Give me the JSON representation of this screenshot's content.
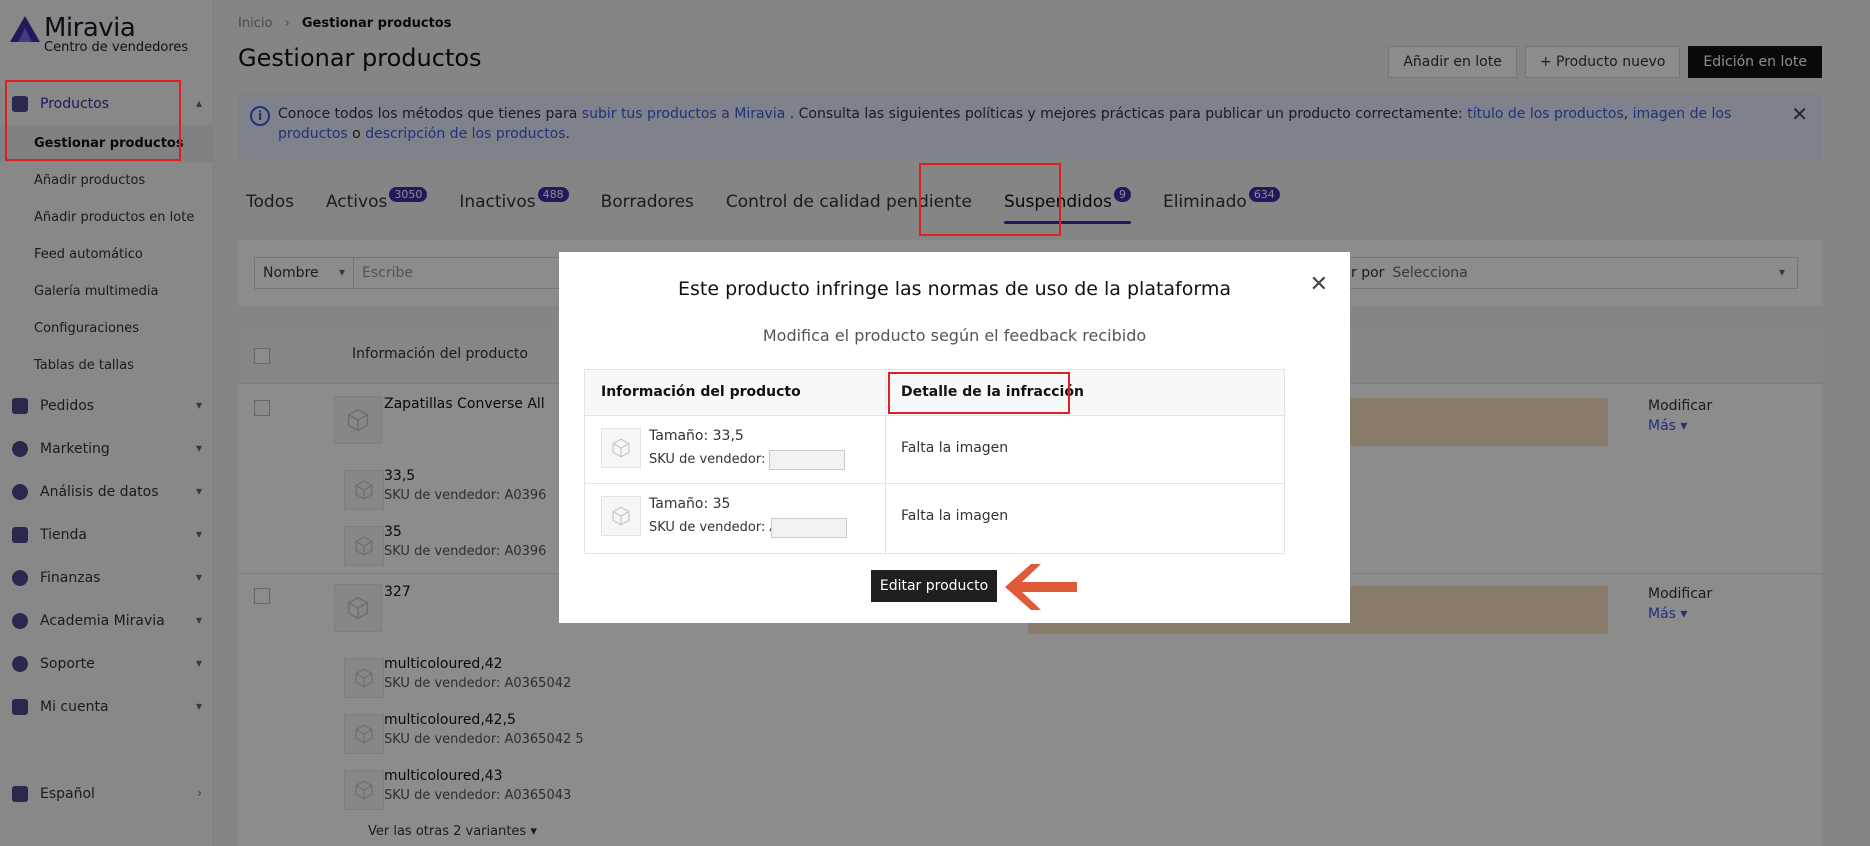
{
  "brand": {
    "name": "Miravia",
    "subtitle": "Centro de vendedores"
  },
  "sidebar": {
    "products_label": "Productos",
    "products_sub": [
      {
        "label": "Gestionar productos"
      },
      {
        "label": "Añadir productos"
      },
      {
        "label": "Añadir productos en lote"
      },
      {
        "label": "Feed automático"
      },
      {
        "label": "Galería multimedia"
      },
      {
        "label": "Configuraciones"
      },
      {
        "label": "Tablas de tallas"
      }
    ],
    "groups": [
      {
        "label": "Pedidos"
      },
      {
        "label": "Marketing"
      },
      {
        "label": "Análisis de datos"
      },
      {
        "label": "Tienda"
      },
      {
        "label": "Finanzas"
      },
      {
        "label": "Academia Miravia"
      },
      {
        "label": "Soporte"
      },
      {
        "label": "Mi cuenta"
      }
    ],
    "language": "Español"
  },
  "breadcrumb": {
    "home": "Inicio",
    "current": "Gestionar productos"
  },
  "page_title": "Gestionar productos",
  "actions": {
    "batch_add": "Añadir en lote",
    "new_product": "+ Producto nuevo",
    "batch_edit": "Edición en lote"
  },
  "banner": {
    "t1": "Conoce todos los métodos que tienes para ",
    "l1": "subir tus productos a Miravia",
    "t2": " . Consulta las siguientes políticas y mejores prácticas para publicar un producto correctamente: ",
    "l2": "título de los productos",
    "t3": ", ",
    "l3": "imagen de los productos",
    "t4": " o ",
    "l4": "descripción de los productos",
    "t5": "."
  },
  "tabs": [
    {
      "label": "Todos",
      "badge": ""
    },
    {
      "label": "Activos",
      "badge": "3050"
    },
    {
      "label": "Inactivos",
      "badge": "488"
    },
    {
      "label": "Borradores",
      "badge": ""
    },
    {
      "label": "Control de calidad pendiente",
      "badge": ""
    },
    {
      "label": "Suspendidos",
      "badge": "9"
    },
    {
      "label": "Eliminado",
      "badge": "634"
    }
  ],
  "filters": {
    "field": "Nombre",
    "placeholder": "Escribe",
    "right_label": "r por",
    "right_value": "Selecciona"
  },
  "table": {
    "header_info": "Información del producto",
    "p1": {
      "name": "Zapatillas Converse All",
      "variants": [
        {
          "name": "33,5",
          "sku": "SKU de vendedor: A0396"
        },
        {
          "name": "35",
          "sku": "SKU de vendedor: A0396"
        }
      ]
    },
    "p2": {
      "name": "327",
      "variants": [
        {
          "name": "multicoloured,42",
          "sku": "SKU de vendedor: A0365042"
        },
        {
          "name": "multicoloured,42,5",
          "sku": "SKU de vendedor: A0365042 5"
        },
        {
          "name": "multicoloured,43",
          "sku": "SKU de vendedor: A0365043"
        }
      ]
    },
    "modify": "Modificar",
    "more": "Más",
    "more_variants": "Ver las otras 2 variantes"
  },
  "modal": {
    "title": "Este producto infringe las normas de uso de la plataforma",
    "subtitle": "Modifica el producto según el feedback recibido",
    "col_info": "Información del producto",
    "col_detail": "Detalle de la infracción",
    "rows": [
      {
        "size": "Tamaño: 33,5",
        "sku": "SKU de vendedor: A",
        "detail": "Falta la imagen"
      },
      {
        "size": "Tamaño: 35",
        "sku": "SKU de vendedor: A(",
        "detail": "Falta la imagen"
      }
    ],
    "edit_button": "Editar producto",
    "close_icon": "close-icon"
  },
  "colors": {
    "accent": "#3b2fa8",
    "highlight": "#e02020",
    "arrow": "#e05a3a"
  }
}
